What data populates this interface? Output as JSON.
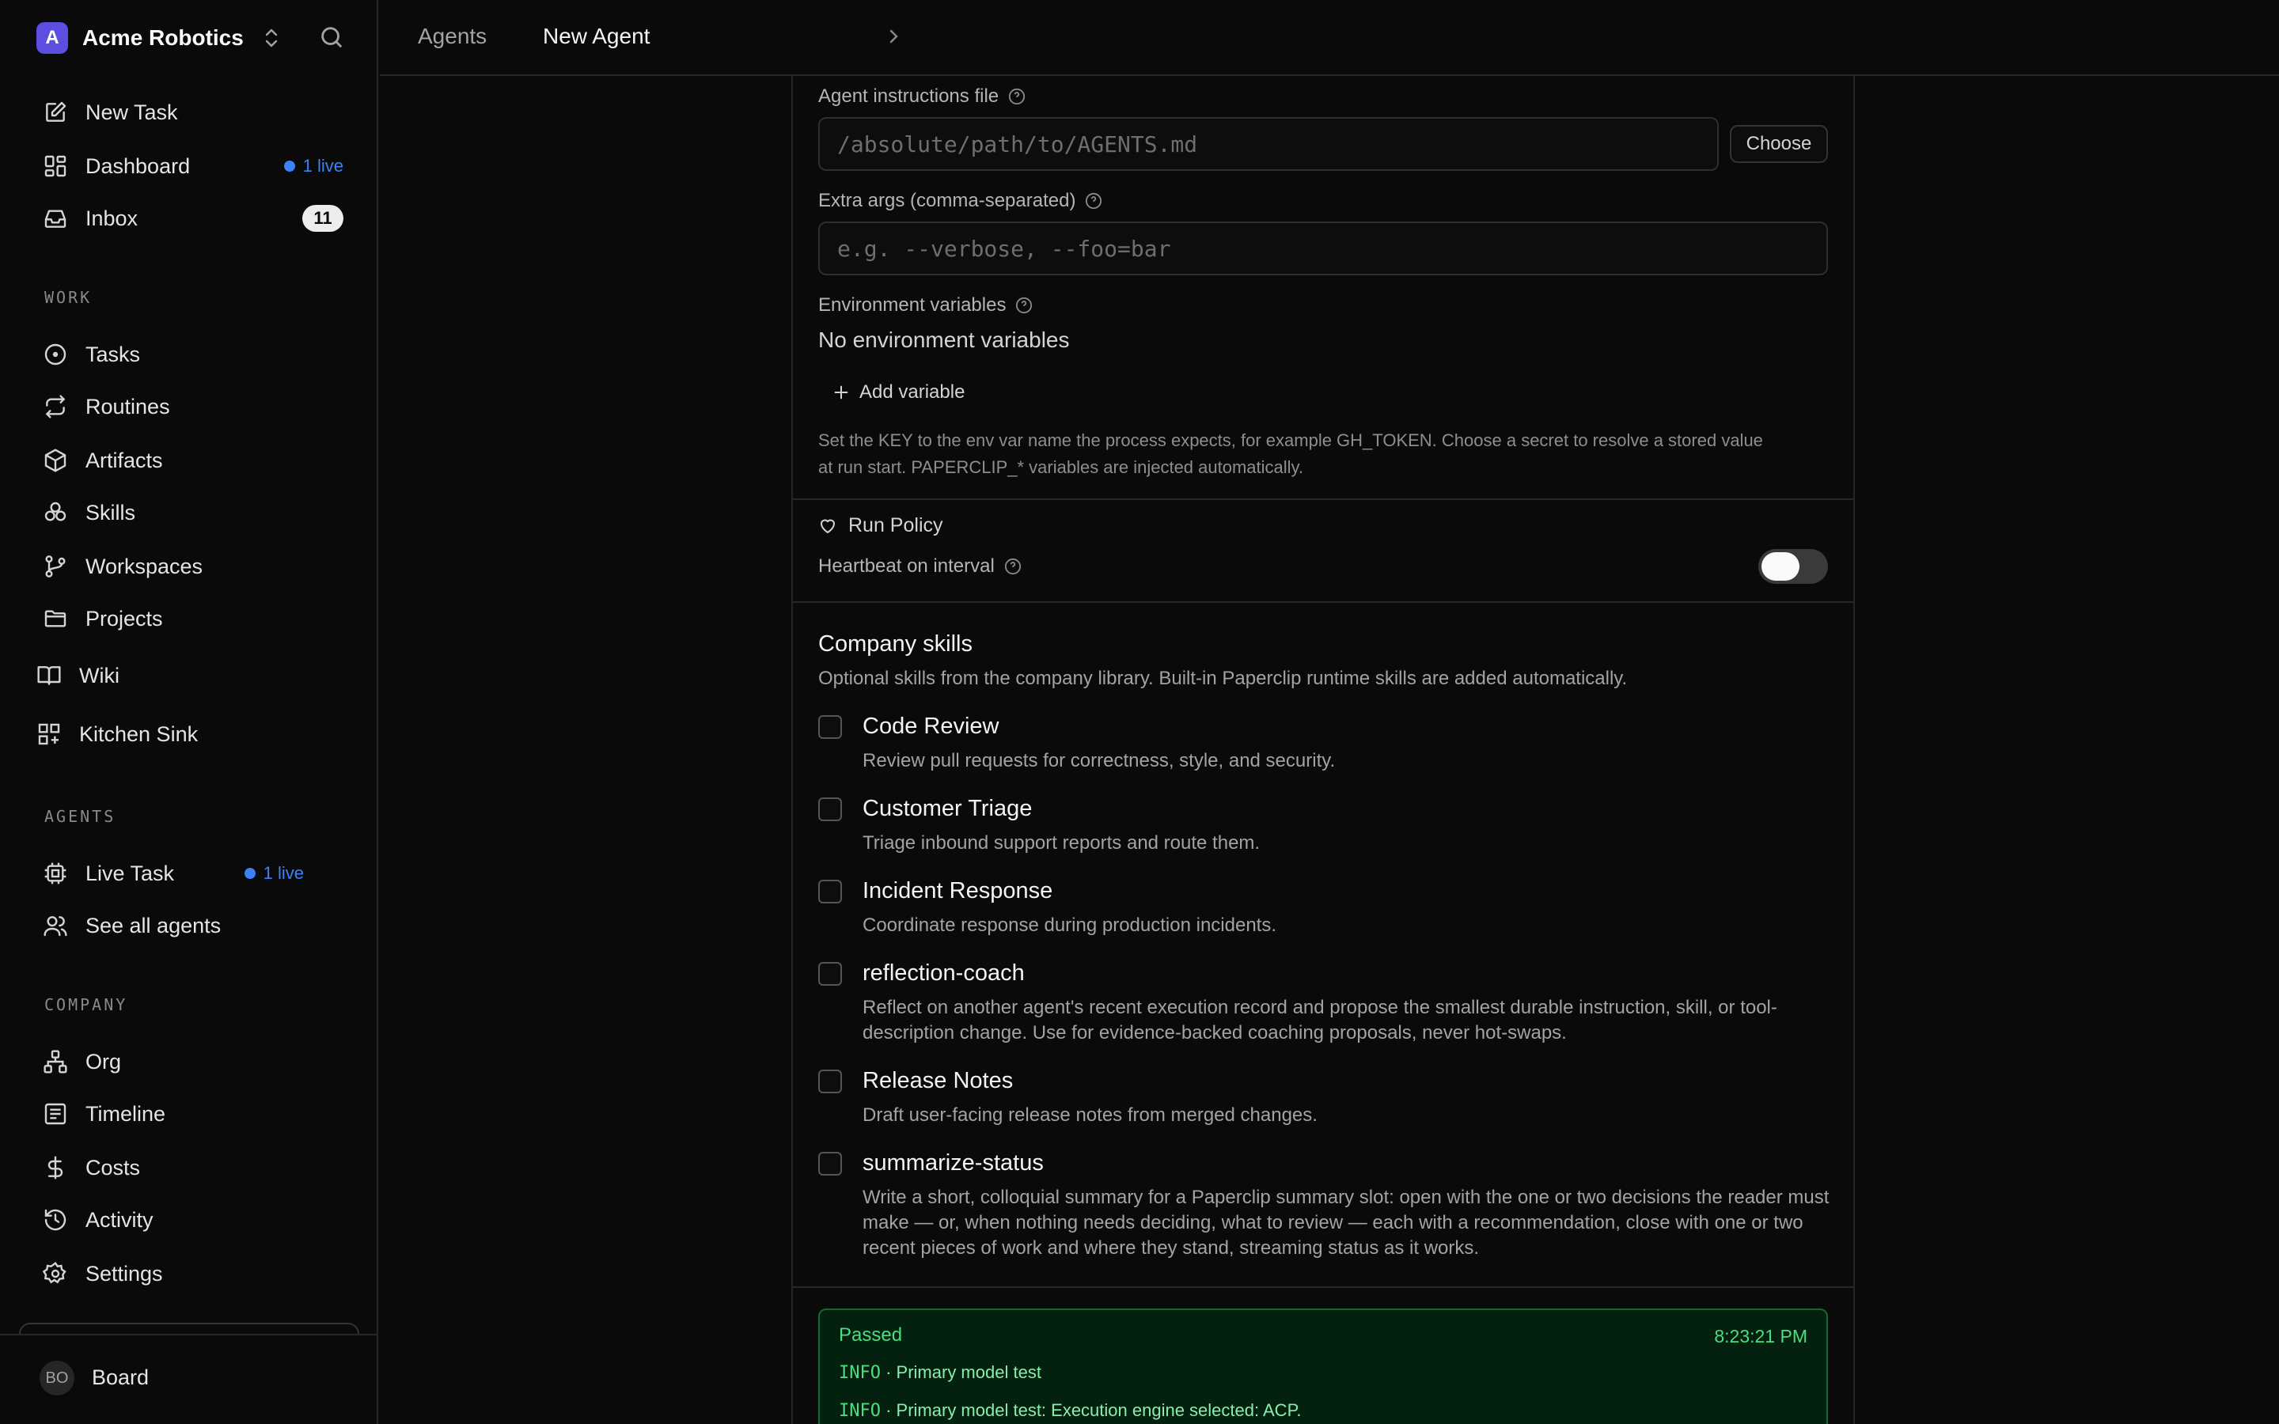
{
  "sidebar": {
    "company": "Acme Robotics",
    "company_initial": "A",
    "top_items": [
      {
        "label": "New Task",
        "icon": "edit-icon"
      },
      {
        "label": "Dashboard",
        "icon": "dashboard-icon",
        "live": "1 live"
      },
      {
        "label": "Inbox",
        "icon": "inbox-icon",
        "badge": "11"
      }
    ],
    "work_label": "WORK",
    "work_items": [
      {
        "label": "Tasks",
        "icon": "circle-dot-icon"
      },
      {
        "label": "Routines",
        "icon": "repeat-icon"
      },
      {
        "label": "Artifacts",
        "icon": "package-icon"
      },
      {
        "label": "Skills",
        "icon": "boxes-icon"
      },
      {
        "label": "Workspaces",
        "icon": "git-branch-icon"
      },
      {
        "label": "Projects",
        "icon": "folder-icon"
      },
      {
        "label": "Wiki",
        "icon": "book-icon"
      },
      {
        "label": "Kitchen Sink",
        "icon": "grid-plus-icon"
      }
    ],
    "agents_label": "AGENTS",
    "agent_items": [
      {
        "label": "Live Task",
        "icon": "cpu-icon",
        "live": "1 live"
      },
      {
        "label": "See all agents",
        "icon": "users-icon"
      }
    ],
    "company_label": "COMPANY",
    "company_items": [
      {
        "label": "Org",
        "icon": "network-icon"
      },
      {
        "label": "Timeline",
        "icon": "list-icon"
      },
      {
        "label": "Costs",
        "icon": "dollar-icon"
      },
      {
        "label": "Activity",
        "icon": "history-icon"
      },
      {
        "label": "Settings",
        "icon": "gear-icon"
      }
    ],
    "user_initials": "BO",
    "user_label": "Board"
  },
  "breadcrumb": {
    "parent": "Agents",
    "current": "New Agent"
  },
  "form": {
    "instructions_label": "Agent instructions file",
    "instructions_placeholder": "/absolute/path/to/AGENTS.md",
    "choose_label": "Choose",
    "extra_args_label": "Extra args (comma-separated)",
    "extra_args_placeholder": "e.g. --verbose, --foo=bar",
    "env_label": "Environment variables",
    "env_empty": "No environment variables",
    "add_variable": "Add variable",
    "env_help_1": "Set the KEY to the env var name the process expects, for example GH_TOKEN. Choose a secret to resolve a stored value",
    "env_help_2": "at run start. PAPERCLIP_* variables are injected automatically.",
    "run_policy": "Run Policy",
    "heartbeat_label": "Heartbeat on interval",
    "heartbeat_on": false
  },
  "skills": {
    "title": "Company skills",
    "subtitle": "Optional skills from the company library. Built-in Paperclip runtime skills are added automatically.",
    "items": [
      {
        "name": "Code Review",
        "desc": "Review pull requests for correctness, style, and security.",
        "checked": false
      },
      {
        "name": "Customer Triage",
        "desc": "Triage inbound support reports and route them.",
        "checked": false
      },
      {
        "name": "Incident Response",
        "desc": "Coordinate response during production incidents.",
        "checked": false
      },
      {
        "name": "reflection-coach",
        "desc": "Reflect on another agent's recent execution record and propose the smallest durable instruction, skill, or tool-description change. Use for evidence-backed coaching proposals, never hot-swaps.",
        "checked": false
      },
      {
        "name": "Release Notes",
        "desc": "Draft user-facing release notes from merged changes.",
        "checked": false
      },
      {
        "name": "summarize-status",
        "desc": "Write a short, colloquial summary for a Paperclip summary slot: open with the one or two decisions the reader must make — or, when nothing needs deciding, what to review — each with a recommendation, close with one or two recent pieces of work and where they stand, streaming status as it works.",
        "checked": false
      }
    ]
  },
  "test_result": {
    "status": "Passed",
    "time": "8:23:21 PM",
    "lines": [
      {
        "level": "INFO",
        "text": "Primary model test"
      },
      {
        "level": "INFO",
        "text": "Primary model test: Execution engine selected: ACP."
      }
    ]
  },
  "colors": {
    "accent": "#5b4ee0",
    "live": "#3b82f6",
    "success": "#4ade80"
  }
}
